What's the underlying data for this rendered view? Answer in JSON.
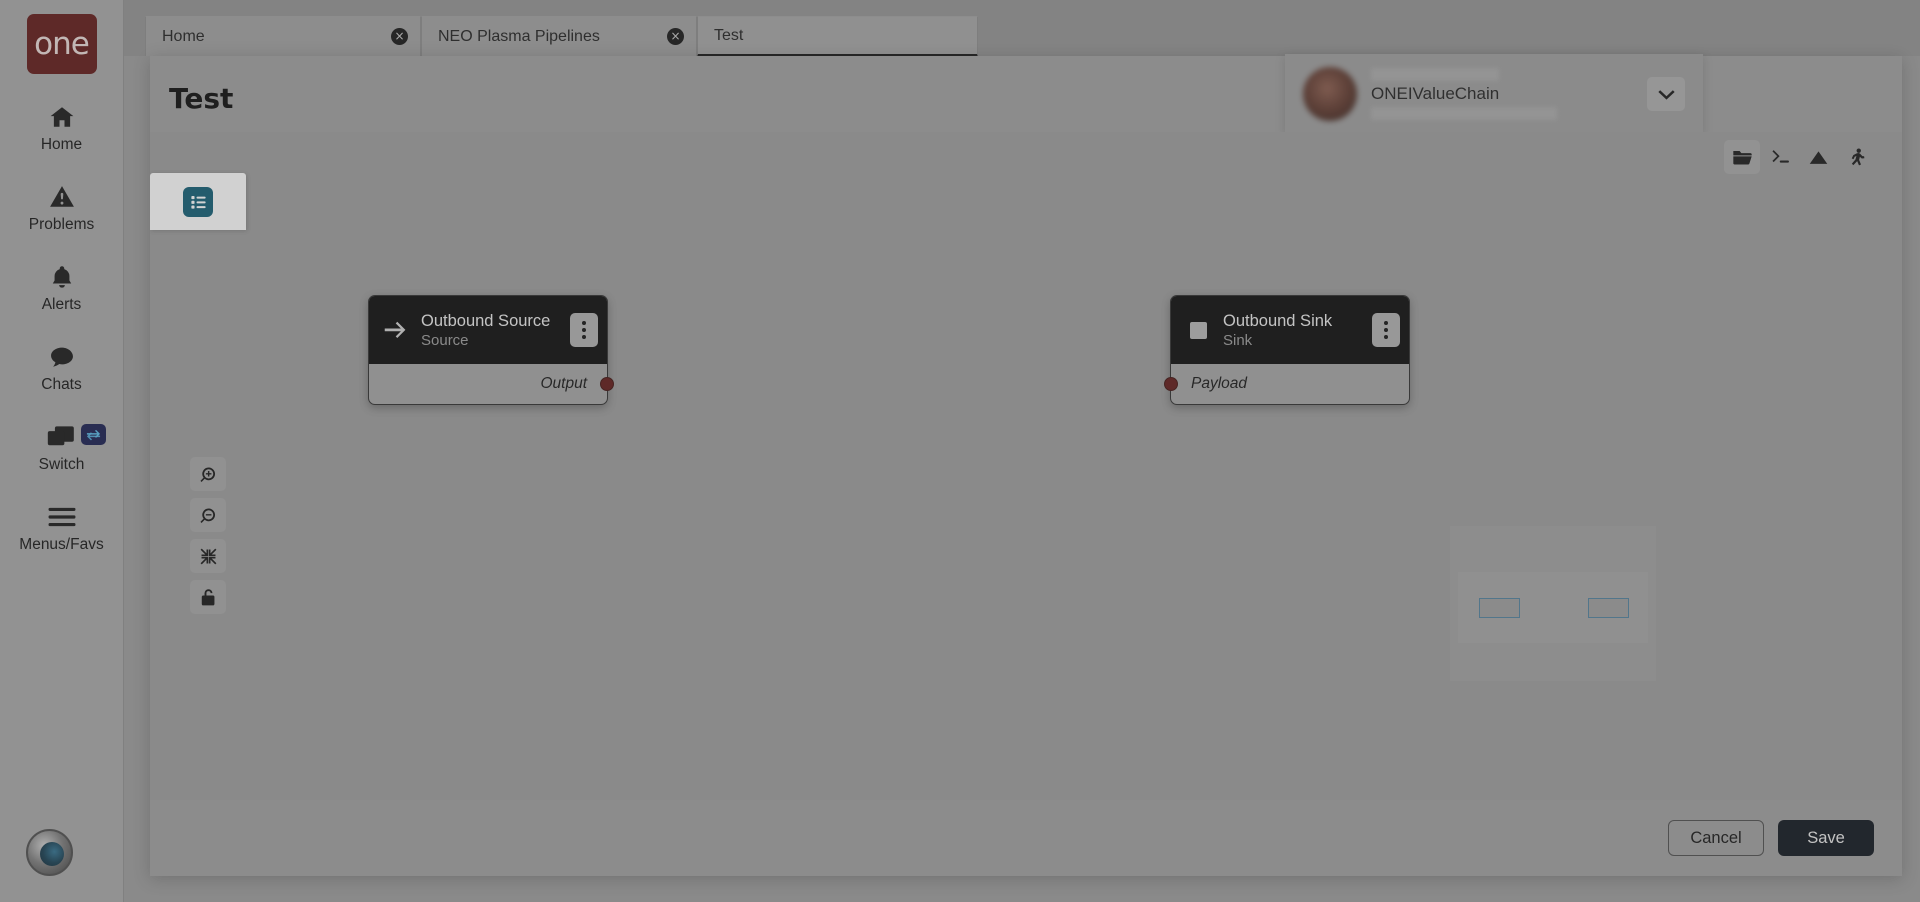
{
  "brand": {
    "wordmark": "one"
  },
  "sidebar": {
    "items": [
      {
        "label": "Home",
        "icon": "home-icon"
      },
      {
        "label": "Problems",
        "icon": "warning-triangle-icon"
      },
      {
        "label": "Alerts",
        "icon": "bell-icon"
      },
      {
        "label": "Chats",
        "icon": "chat-bubble-icon"
      },
      {
        "label": "Switch",
        "icon": "windows-stack-icon",
        "badge_icon": "swap-arrows-icon"
      },
      {
        "label": "Menus/Favs",
        "icon": "hamburger-icon"
      }
    ],
    "avatar": "user-avatar-icon"
  },
  "tabs": [
    {
      "label": "Home",
      "active": false,
      "close_label": "×"
    },
    {
      "label": "NEO Plasma Pipelines",
      "active": false,
      "close_label": "×"
    },
    {
      "label": "Test",
      "active": true,
      "close_label": "×"
    }
  ],
  "header": {
    "title": "Test",
    "buttons": [
      {
        "name": "favorite-button",
        "icon": "star-icon"
      },
      {
        "name": "refresh-button",
        "icon": "refresh-icon"
      },
      {
        "name": "close-button",
        "icon": "close-x-icon"
      }
    ],
    "menu_icon": "hamburger-icon",
    "menu_badge_icon": "star-icon"
  },
  "user": {
    "org": "ONEIValueChain",
    "caret_icon": "chevron-down-icon"
  },
  "canvas": {
    "palette_toggle_icon": "list-icon",
    "toolbar": [
      {
        "name": "open-folder-button",
        "icon": "folder-open-icon",
        "active": true
      },
      {
        "name": "console-button",
        "icon": "terminal-icon",
        "active": false
      },
      {
        "name": "image-button",
        "icon": "image-triangle-icon",
        "active": false
      },
      {
        "name": "run-button",
        "icon": "running-person-icon",
        "active": false
      }
    ],
    "zoom_controls": [
      {
        "name": "zoom-in-button",
        "icon": "zoom-in-icon"
      },
      {
        "name": "zoom-out-button",
        "icon": "zoom-out-icon"
      },
      {
        "name": "fit-to-screen-button",
        "icon": "collapse-arrows-icon"
      },
      {
        "name": "lock-button",
        "icon": "lock-open-icon"
      }
    ],
    "nodes": [
      {
        "id": "source",
        "name": "Outbound Source",
        "subtitle": "Source",
        "icon": "arrow-right-icon",
        "port_label": "Output",
        "port_side": "right",
        "port_color": "#5e1412",
        "kebab_icon": "kebab-menu-icon"
      },
      {
        "id": "sink",
        "name": "Outbound Sink",
        "subtitle": "Sink",
        "icon": "square-icon",
        "port_label": "Payload",
        "port_side": "left",
        "port_color": "#5e1412",
        "kebab_icon": "kebab-menu-icon"
      }
    ],
    "minimap": {
      "node_count": 2,
      "outline_color": "#4d7f9b"
    }
  },
  "footer": {
    "cancel_label": "Cancel",
    "save_label": "Save"
  },
  "colors": {
    "brand_maroon": "#5e1412",
    "accent_teal": "#0d5b72",
    "node_header": "#060606",
    "save_button": "#0b1119",
    "page_background": "#9a9a9a"
  }
}
